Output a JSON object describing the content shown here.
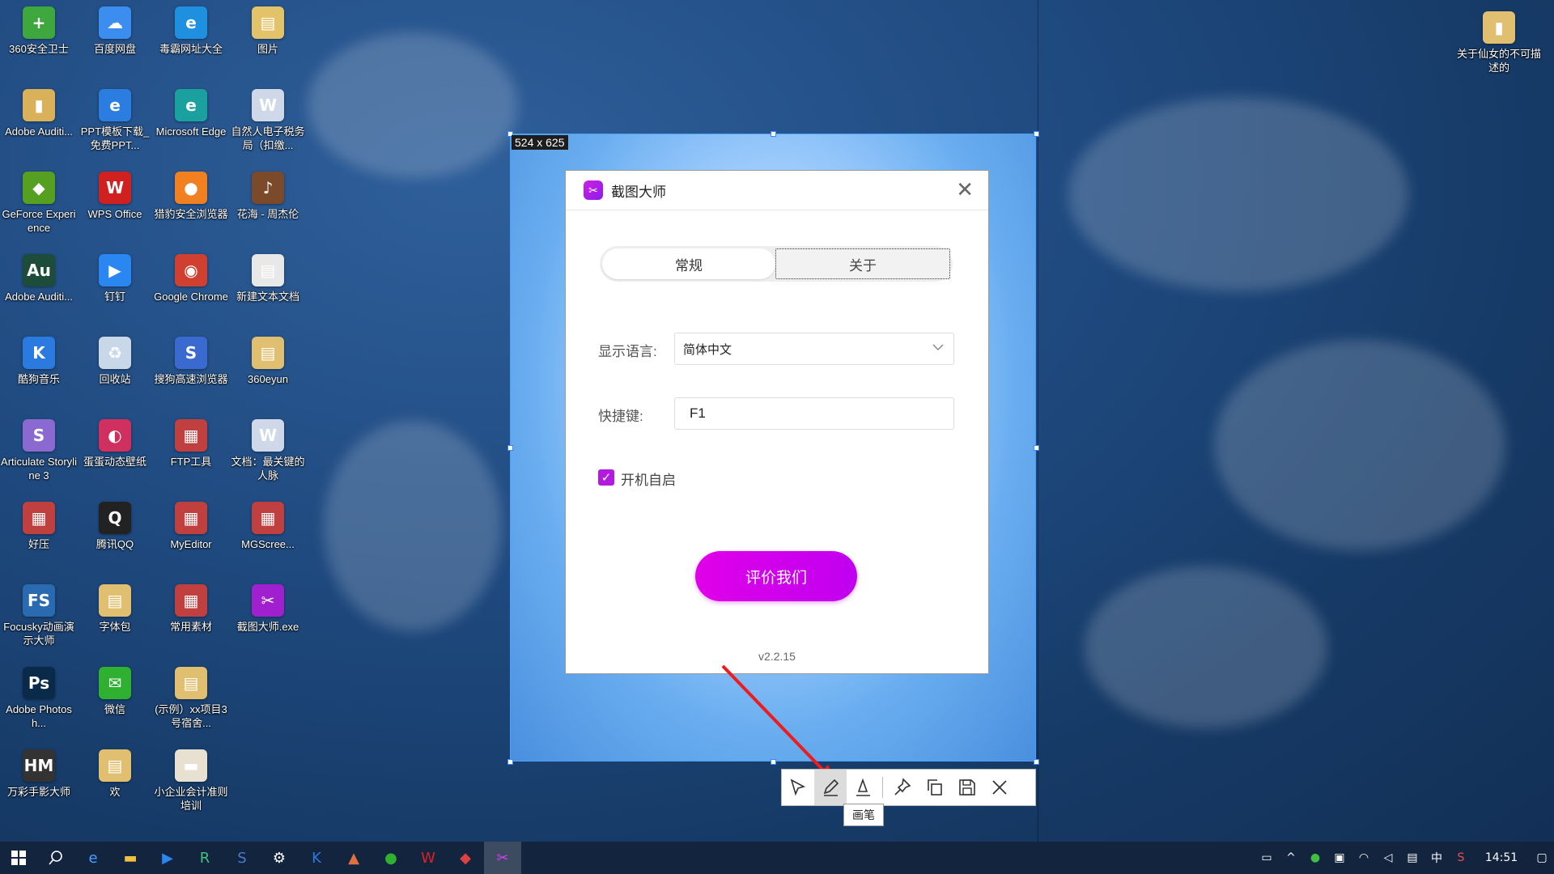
{
  "desktop": {
    "icons": [
      {
        "label": "360安全卫士",
        "color": "#3ea73e",
        "glyph": "+"
      },
      {
        "label": "百度网盘",
        "color": "#3c8df0",
        "glyph": "☁"
      },
      {
        "label": "毒霸网址大全",
        "color": "#1f8fe0",
        "glyph": "e"
      },
      {
        "label": "图片",
        "color": "#e3c36a",
        "glyph": "▤"
      },
      {
        "label": "Adobe Auditi...",
        "color": "#d8b15a",
        "glyph": "▮"
      },
      {
        "label": "PPT模板下载_免费PPT...",
        "color": "#2b7ee0",
        "glyph": "e"
      },
      {
        "label": "Microsoft Edge",
        "color": "#1ba0a0",
        "glyph": "e"
      },
      {
        "label": "自然人电子税务局（扣缴...",
        "color": "#cfd8e8",
        "glyph": "W"
      },
      {
        "label": "GeForce Experience",
        "color": "#55a020",
        "glyph": "◆"
      },
      {
        "label": "WPS Office",
        "color": "#d02020",
        "glyph": "W"
      },
      {
        "label": "猎豹安全浏览器",
        "color": "#f08020",
        "glyph": "●"
      },
      {
        "label": "花海 - 周杰伦",
        "color": "#7a4a2a",
        "glyph": "♪"
      },
      {
        "label": "Adobe Auditi...",
        "color": "#1d4d3a",
        "glyph": "Au"
      },
      {
        "label": "钉钉",
        "color": "#2a86f0",
        "glyph": "▶"
      },
      {
        "label": "Google Chrome",
        "color": "#d04030",
        "glyph": "◉"
      },
      {
        "label": "新建文本文档",
        "color": "#e8e8e8",
        "glyph": "▤"
      },
      {
        "label": "酷狗音乐",
        "color": "#2a7ae0",
        "glyph": "K"
      },
      {
        "label": "回收站",
        "color": "#c8d8e8",
        "glyph": "♻"
      },
      {
        "label": "搜狗高速浏览器",
        "color": "#3a6ad0",
        "glyph": "S"
      },
      {
        "label": "360eyun",
        "color": "#e0c070",
        "glyph": "▤"
      },
      {
        "label": "Articulate Storyline 3",
        "color": "#8a6ad0",
        "glyph": "S"
      },
      {
        "label": "蛋蛋动态壁纸",
        "color": "#d03060",
        "glyph": "◐"
      },
      {
        "label": "FTP工具",
        "color": "#c04040",
        "glyph": "▦"
      },
      {
        "label": "文档：最关键的人脉",
        "color": "#cfd8e8",
        "glyph": "W"
      },
      {
        "label": "好压",
        "color": "#c04040",
        "glyph": "▦"
      },
      {
        "label": "腾讯QQ",
        "color": "#222222",
        "glyph": "Q"
      },
      {
        "label": "MyEditor",
        "color": "#c04040",
        "glyph": "▦"
      },
      {
        "label": "MGScree...",
        "color": "#c04040",
        "glyph": "▦"
      },
      {
        "label": "Focusky动画演示大师",
        "color": "#2a6ab0",
        "glyph": "FS"
      },
      {
        "label": "字体包",
        "color": "#e0c070",
        "glyph": "▤"
      },
      {
        "label": "常用素材",
        "color": "#c04040",
        "glyph": "▦"
      },
      {
        "label": "截图大师.exe",
        "color": "#a020d0",
        "glyph": "✂"
      },
      {
        "label": "Adobe Photosh...",
        "color": "#0a2a4a",
        "glyph": "Ps"
      },
      {
        "label": "微信",
        "color": "#30b030",
        "glyph": "✉"
      },
      {
        "label": "(示例）xx项目3号宿舍...",
        "color": "#e0c070",
        "glyph": "▤"
      },
      {
        "label": "",
        "color": "transparent",
        "glyph": ""
      },
      {
        "label": "万彩手影大师",
        "color": "#333333",
        "glyph": "HM"
      },
      {
        "label": "欢",
        "color": "#e0c070",
        "glyph": "▤"
      },
      {
        "label": "小企业会计准则培训",
        "color": "#e8e0d0",
        "glyph": "▬"
      },
      {
        "label": "",
        "color": "transparent",
        "glyph": ""
      }
    ],
    "top_right_icon": {
      "label": "关于仙女的不可描述的",
      "color": "#e0c070",
      "glyph": "▮"
    }
  },
  "capture": {
    "size_label": "524 x 625"
  },
  "dialog": {
    "title": "截图大师",
    "close_glyph": "✕",
    "tabs": [
      "常规",
      "关于"
    ],
    "language_label": "显示语言:",
    "language_value": "简体中文",
    "hotkey_label": "快捷键:",
    "hotkey_value": "F1",
    "autostart_label": "开机自启",
    "autostart_checked": true,
    "rate_button": "评价我们",
    "version": "v2.2.15",
    "accent_color": "#c000f0"
  },
  "toolbar": {
    "tools": [
      "select-arrow-icon",
      "pen-icon",
      "marker-icon",
      "pin-icon",
      "copy-icon",
      "save-icon",
      "close-icon"
    ],
    "active_tool": "pen-icon",
    "tooltip": "画笔"
  },
  "taskbar": {
    "time": "14:51",
    "ime": "中"
  }
}
